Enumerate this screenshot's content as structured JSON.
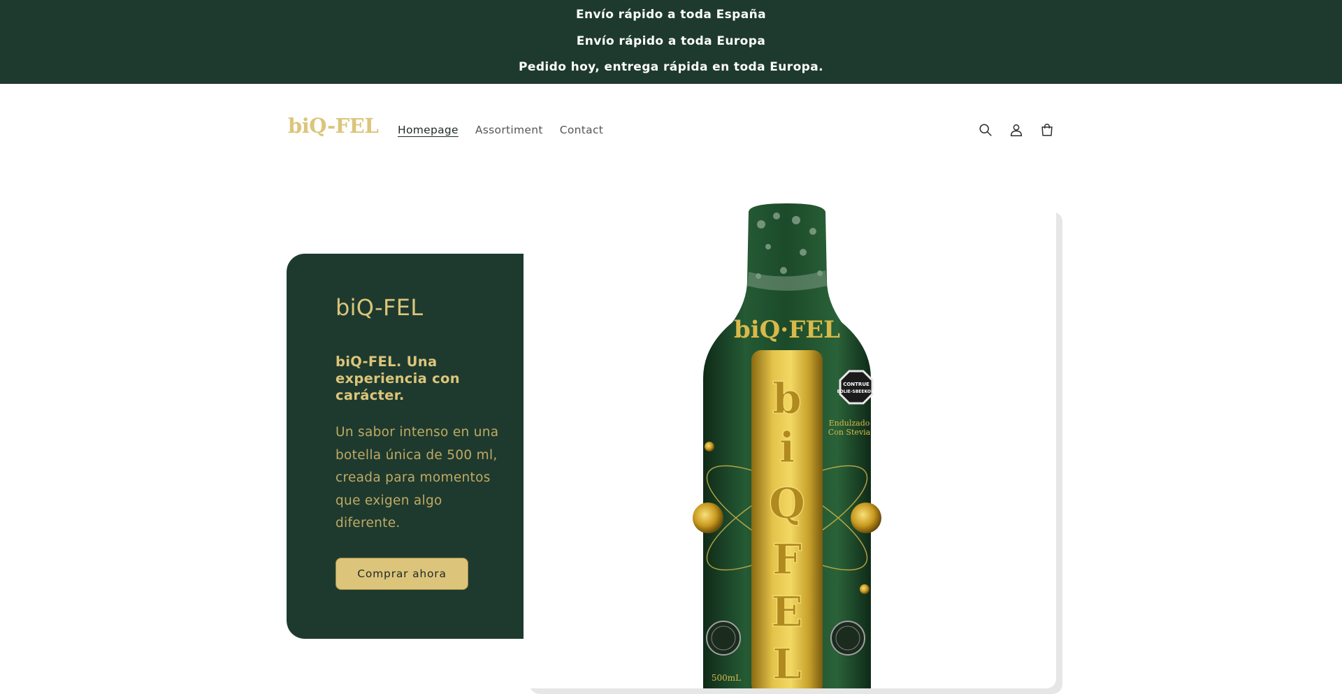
{
  "announcement": {
    "line1": "Envío rápido a toda España",
    "line2": "Envío rápido a toda Europa",
    "line3": "Pedido hoy, entrega rápida en toda Europa."
  },
  "header": {
    "logo": "biQ-FEL",
    "nav": [
      {
        "label": "Homepage",
        "active": true
      },
      {
        "label": "Assortiment",
        "active": false
      },
      {
        "label": "Contact",
        "active": false
      }
    ],
    "icons": [
      "search-icon",
      "account-icon",
      "cart-icon"
    ]
  },
  "hero": {
    "title": "biQ-FEL",
    "subtitle": "biQ-FEL. Una experiencia con carácter.",
    "description": "Un sabor intenso en una botella única de 500 ml, creada para momentos que exigen algo diferente.",
    "button_label": "Comprar ahora"
  },
  "product_image": {
    "brand": "biQ·FEL",
    "vertical_text": "biQFEL",
    "badge": "CONTRUE EDLIE-SBEEKOIE",
    "side_text": "Endulzado Con Stevia",
    "volume": "500mL"
  },
  "colors": {
    "brand_dark_green": "#1e3a2f",
    "brand_gold": "#dcc57a",
    "text_gold_muted": "#c0aa62",
    "bottle_green": "#1f4a2c"
  }
}
